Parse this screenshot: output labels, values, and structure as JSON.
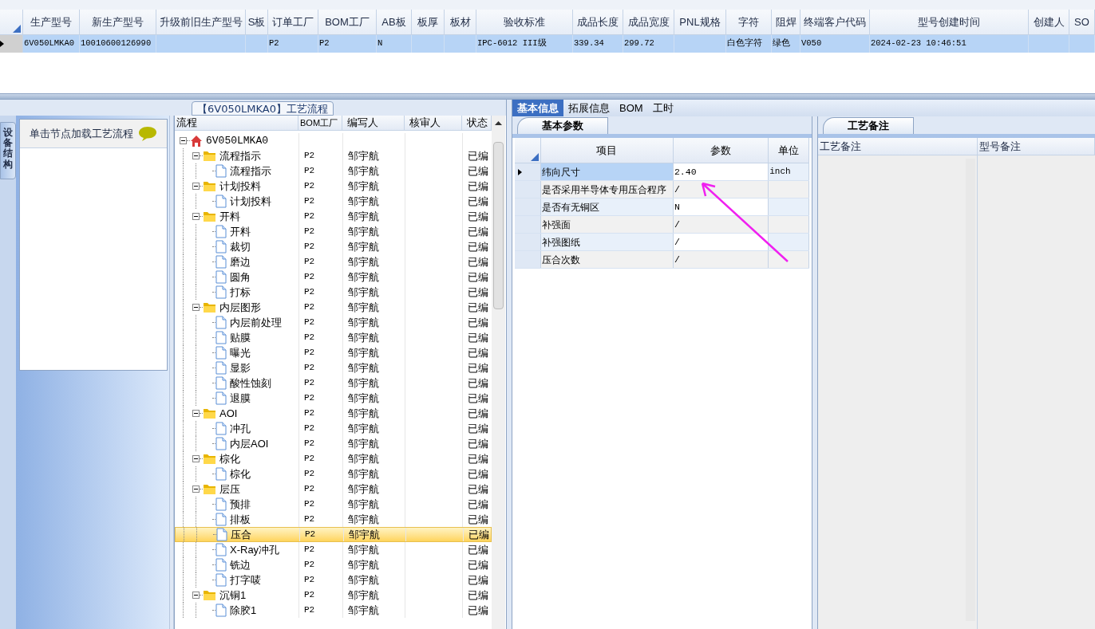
{
  "top_table": {
    "columns": [
      "生产型号",
      "新生产型号",
      "升级前旧生产型号",
      "S板",
      "订单工厂",
      "BOM工厂",
      "AB板",
      "板厚",
      "板材",
      "验收标准",
      "成品长度",
      "成品宽度",
      "PNL规格",
      "字符",
      "阻焊",
      "终端客户代码",
      "型号创建时间",
      "创建人",
      "SO"
    ],
    "rows": [
      {
        "selected": true,
        "cells": [
          "6V050LMKA0",
          "10010600126990",
          "",
          "",
          "P2",
          "P2",
          "N",
          "",
          "",
          "IPC-6012 III级",
          "339.34",
          "299.72",
          "",
          "白色字符",
          "绿色",
          "V050",
          "2024-02-23 10:46:51",
          "",
          ""
        ]
      }
    ]
  },
  "flow_panel": {
    "title": "【6V050LMKA0】工艺流程",
    "side_tab": "设备结构",
    "hint": "单击节点加载工艺流程",
    "columns": [
      "流程",
      "BOM工厂",
      "编写人",
      "核审人",
      "状态"
    ],
    "tree": [
      {
        "kind": "home",
        "name": "6V050LMKA0",
        "expanded": true,
        "selected": false,
        "children": [
          {
            "kind": "folder",
            "name": "流程指示",
            "bom": "P2",
            "author": "邹宇航",
            "status": "已编",
            "expanded": true,
            "selected": false,
            "children": [
              {
                "kind": "file",
                "name": "流程指示",
                "bom": "P2",
                "author": "邹宇航",
                "status": "已编",
                "selected": false
              }
            ]
          },
          {
            "kind": "folder",
            "name": "计划投料",
            "bom": "P2",
            "author": "邹宇航",
            "status": "已编",
            "expanded": true,
            "selected": false,
            "children": [
              {
                "kind": "file",
                "name": "计划投料",
                "bom": "P2",
                "author": "邹宇航",
                "status": "已编",
                "selected": false
              }
            ]
          },
          {
            "kind": "folder",
            "name": "开料",
            "bom": "P2",
            "author": "邹宇航",
            "status": "已编",
            "expanded": true,
            "selected": false,
            "children": [
              {
                "kind": "file",
                "name": "开料",
                "bom": "P2",
                "author": "邹宇航",
                "status": "已编",
                "selected": false
              },
              {
                "kind": "file",
                "name": "裁切",
                "bom": "P2",
                "author": "邹宇航",
                "status": "已编",
                "selected": false
              },
              {
                "kind": "file",
                "name": "磨边",
                "bom": "P2",
                "author": "邹宇航",
                "status": "已编",
                "selected": false
              },
              {
                "kind": "file",
                "name": "圆角",
                "bom": "P2",
                "author": "邹宇航",
                "status": "已编",
                "selected": false
              },
              {
                "kind": "file",
                "name": "打标",
                "bom": "P2",
                "author": "邹宇航",
                "status": "已编",
                "selected": false
              }
            ]
          },
          {
            "kind": "folder",
            "name": "内层图形",
            "bom": "P2",
            "author": "邹宇航",
            "status": "已编",
            "expanded": true,
            "selected": false,
            "children": [
              {
                "kind": "file",
                "name": "内层前处理",
                "bom": "P2",
                "author": "邹宇航",
                "status": "已编",
                "selected": false
              },
              {
                "kind": "file",
                "name": "贴膜",
                "bom": "P2",
                "author": "邹宇航",
                "status": "已编",
                "selected": false
              },
              {
                "kind": "file",
                "name": "曝光",
                "bom": "P2",
                "author": "邹宇航",
                "status": "已编",
                "selected": false
              },
              {
                "kind": "file",
                "name": "显影",
                "bom": "P2",
                "author": "邹宇航",
                "status": "已编",
                "selected": false
              },
              {
                "kind": "file",
                "name": "酸性蚀刻",
                "bom": "P2",
                "author": "邹宇航",
                "status": "已编",
                "selected": false
              },
              {
                "kind": "file",
                "name": "退膜",
                "bom": "P2",
                "author": "邹宇航",
                "status": "已编",
                "selected": false
              }
            ]
          },
          {
            "kind": "folder",
            "name": "AOI",
            "bom": "P2",
            "author": "邹宇航",
            "status": "已编",
            "expanded": true,
            "selected": false,
            "children": [
              {
                "kind": "file",
                "name": "冲孔",
                "bom": "P2",
                "author": "邹宇航",
                "status": "已编",
                "selected": false
              },
              {
                "kind": "file",
                "name": "内层AOI",
                "bom": "P2",
                "author": "邹宇航",
                "status": "已编",
                "selected": false
              }
            ]
          },
          {
            "kind": "folder",
            "name": "棕化",
            "bom": "P2",
            "author": "邹宇航",
            "status": "已编",
            "expanded": true,
            "selected": false,
            "children": [
              {
                "kind": "file",
                "name": "棕化",
                "bom": "P2",
                "author": "邹宇航",
                "status": "已编",
                "selected": false
              }
            ]
          },
          {
            "kind": "folder",
            "name": "层压",
            "bom": "P2",
            "author": "邹宇航",
            "status": "已编",
            "expanded": true,
            "selected": false,
            "children": [
              {
                "kind": "file",
                "name": "预排",
                "bom": "P2",
                "author": "邹宇航",
                "status": "已编",
                "selected": false
              },
              {
                "kind": "file",
                "name": "排板",
                "bom": "P2",
                "author": "邹宇航",
                "status": "已编",
                "selected": false
              },
              {
                "kind": "file",
                "name": "压合",
                "bom": "P2",
                "author": "邹宇航",
                "status": "已编",
                "selected": true
              },
              {
                "kind": "file",
                "name": "X-Ray冲孔",
                "bom": "P2",
                "author": "邹宇航",
                "status": "已编",
                "selected": false
              },
              {
                "kind": "file",
                "name": "铣边",
                "bom": "P2",
                "author": "邹宇航",
                "status": "已编",
                "selected": false
              },
              {
                "kind": "file",
                "name": "打字唛",
                "bom": "P2",
                "author": "邹宇航",
                "status": "已编",
                "selected": false
              }
            ]
          },
          {
            "kind": "folder",
            "name": "沉铜1",
            "bom": "P2",
            "author": "邹宇航",
            "status": "已编",
            "expanded": true,
            "selected": false,
            "children": [
              {
                "kind": "file",
                "name": "除胶1",
                "bom": "P2",
                "author": "邹宇航",
                "status": "已编",
                "selected": false
              }
            ]
          }
        ]
      }
    ]
  },
  "detail_tabs": [
    {
      "label": "基本信息",
      "selected": true
    },
    {
      "label": "拓展信息",
      "selected": false
    },
    {
      "label": "BOM",
      "selected": false
    },
    {
      "label": "工时",
      "selected": false
    }
  ],
  "params_panel": {
    "tab": "基本参数",
    "columns": [
      "项目",
      "参数",
      "单位"
    ],
    "rows": [
      {
        "item": "纬向尺寸",
        "value": "2.40",
        "unit": "inch",
        "selected": true
      },
      {
        "item": "是否采用半导体专用压合程序",
        "value": "/",
        "selected": false
      },
      {
        "item": "是否有无铜区",
        "value": "N",
        "selected": false
      },
      {
        "item": "补强面",
        "value": "/",
        "selected": false
      },
      {
        "item": "补强图纸",
        "value": "/",
        "selected": false
      },
      {
        "item": "压合次数",
        "value": "/",
        "selected": false
      }
    ]
  },
  "notes_panel": {
    "tab": "工艺备注",
    "columns": [
      "工艺备注",
      "型号备注"
    ]
  }
}
